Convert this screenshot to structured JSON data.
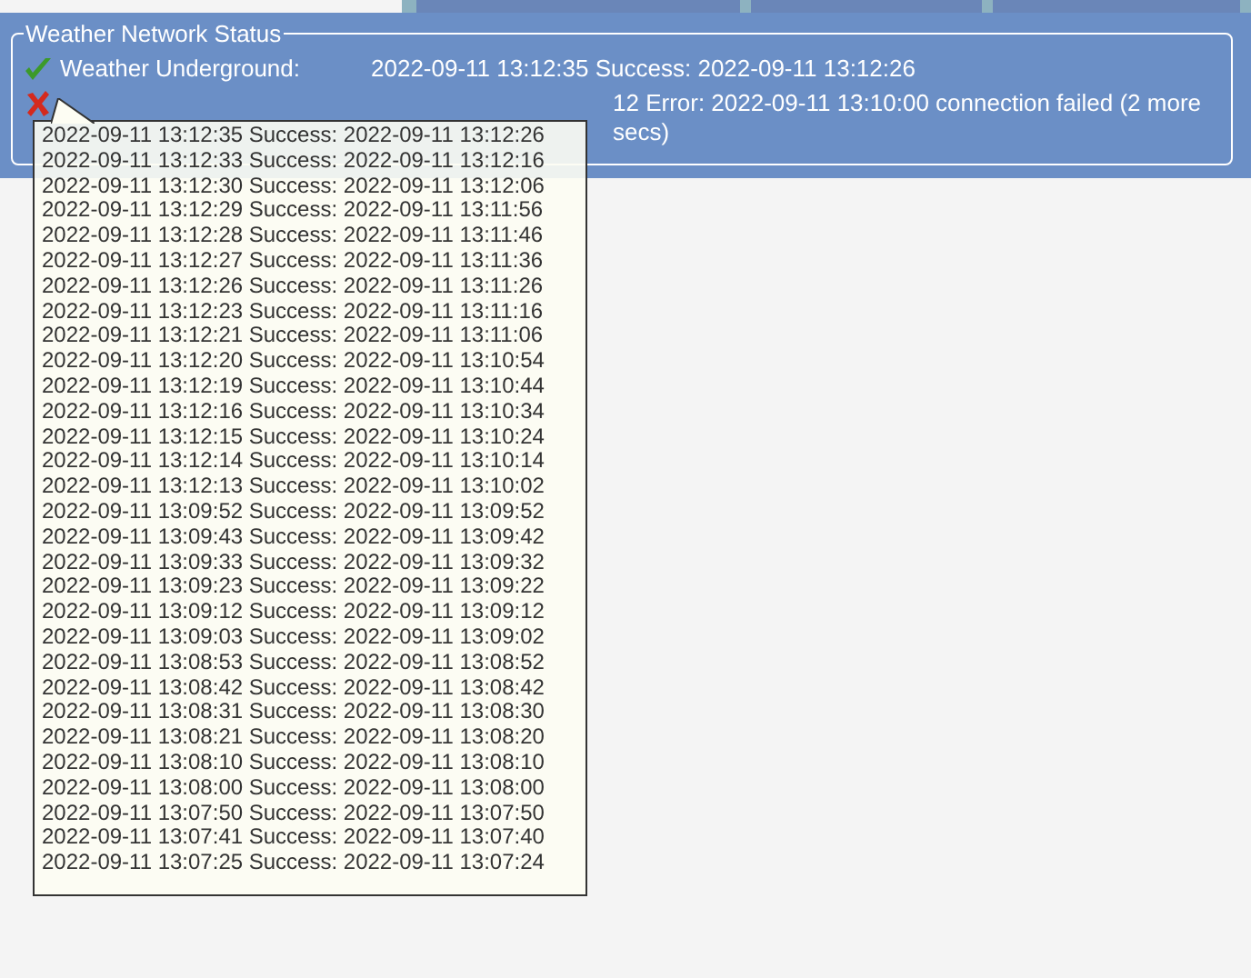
{
  "tabs": [
    {
      "selected": true
    },
    {
      "selected": false
    },
    {
      "selected": false
    },
    {
      "selected": false
    }
  ],
  "panel": {
    "legend": "Weather Network Status",
    "rows": [
      {
        "kind": "ok",
        "label": "Weather Underground:",
        "lines": [
          "2022-09-11 13:12:35 Success: 2022-09-11 13:12:26"
        ]
      },
      {
        "kind": "error",
        "label": "",
        "lines": [
          "12 Error: 2022-09-11 13:10:00 connection failed (2 more",
          "secs)"
        ]
      }
    ]
  },
  "tooltip": {
    "lines": [
      "2022-09-11 13:12:35 Success: 2022-09-11 13:12:26",
      "2022-09-11 13:12:33 Success: 2022-09-11 13:12:16",
      "2022-09-11 13:12:30 Success: 2022-09-11 13:12:06",
      "2022-09-11 13:12:29 Success: 2022-09-11 13:11:56",
      "2022-09-11 13:12:28 Success: 2022-09-11 13:11:46",
      "2022-09-11 13:12:27 Success: 2022-09-11 13:11:36",
      "2022-09-11 13:12:26 Success: 2022-09-11 13:11:26",
      "2022-09-11 13:12:23 Success: 2022-09-11 13:11:16",
      "2022-09-11 13:12:21 Success: 2022-09-11 13:11:06",
      "2022-09-11 13:12:20 Success: 2022-09-11 13:10:54",
      "2022-09-11 13:12:19 Success: 2022-09-11 13:10:44",
      "2022-09-11 13:12:16 Success: 2022-09-11 13:10:34",
      "2022-09-11 13:12:15 Success: 2022-09-11 13:10:24",
      "2022-09-11 13:12:14 Success: 2022-09-11 13:10:14",
      "2022-09-11 13:12:13 Success: 2022-09-11 13:10:02",
      "2022-09-11 13:09:52 Success: 2022-09-11 13:09:52",
      "2022-09-11 13:09:43 Success: 2022-09-11 13:09:42",
      "2022-09-11 13:09:33 Success: 2022-09-11 13:09:32",
      "2022-09-11 13:09:23 Success: 2022-09-11 13:09:22",
      "2022-09-11 13:09:12 Success: 2022-09-11 13:09:12",
      "2022-09-11 13:09:03 Success: 2022-09-11 13:09:02",
      "2022-09-11 13:08:53 Success: 2022-09-11 13:08:52",
      "2022-09-11 13:08:42 Success: 2022-09-11 13:08:42",
      "2022-09-11 13:08:31 Success: 2022-09-11 13:08:30",
      "2022-09-11 13:08:21 Success: 2022-09-11 13:08:20",
      "2022-09-11 13:08:10 Success: 2022-09-11 13:08:10",
      "2022-09-11 13:08:00 Success: 2022-09-11 13:08:00",
      "2022-09-11 13:07:50 Success: 2022-09-11 13:07:50",
      "2022-09-11 13:07:41 Success: 2022-09-11 13:07:40",
      "2022-09-11 13:07:25 Success: 2022-09-11 13:07:24"
    ]
  }
}
